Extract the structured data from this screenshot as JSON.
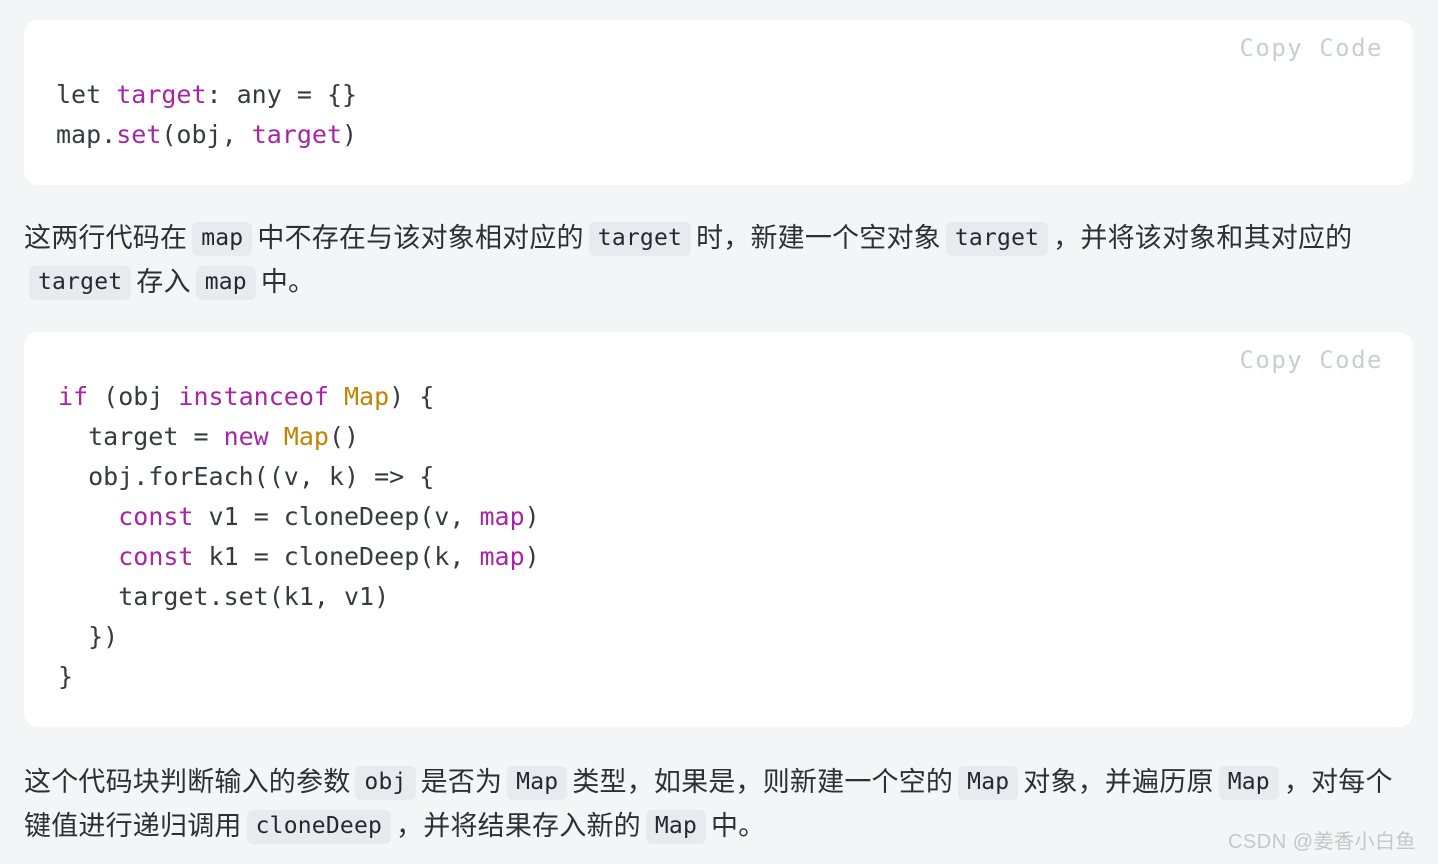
{
  "page": {
    "background": "#f4f5f7",
    "watermark": "CSDN @姜香小白鱼"
  },
  "theme": {
    "code_background": "#ffffff",
    "keyword_color": "#a626a4",
    "class_color": "#c18401",
    "plain_color": "#383a42",
    "copy_label_color": "#c9ced3",
    "chip_background": "#e8eaed"
  },
  "code_block_1": {
    "copy_label": "Copy Code",
    "language": "typescript",
    "lines": [
      {
        "tokens": [
          {
            "text": "let ",
            "kind": "plain"
          },
          {
            "text": "target",
            "kind": "var"
          },
          {
            "text": ": any = {}",
            "kind": "plain"
          }
        ]
      },
      {
        "tokens": [
          {
            "text": "map.",
            "kind": "plain"
          },
          {
            "text": "set",
            "kind": "fn"
          },
          {
            "text": "(obj, ",
            "kind": "plain"
          },
          {
            "text": "target",
            "kind": "var"
          },
          {
            "text": ")",
            "kind": "plain"
          }
        ]
      }
    ],
    "plain_text": "let target: any = {}\nmap.set(obj, target)"
  },
  "paragraph_1": {
    "segments": [
      {
        "type": "text",
        "value": "这两行代码在"
      },
      {
        "type": "code",
        "value": "map"
      },
      {
        "type": "text",
        "value": "中不存在与该对象相对应的"
      },
      {
        "type": "code",
        "value": "target"
      },
      {
        "type": "text",
        "value": "时，新建一个空对象"
      },
      {
        "type": "code",
        "value": "target"
      },
      {
        "type": "text",
        "value": "，并将该对象和其对应的"
      },
      {
        "type": "code",
        "value": "target"
      },
      {
        "type": "text",
        "value": "存入"
      },
      {
        "type": "code",
        "value": "map"
      },
      {
        "type": "text",
        "value": "中。"
      }
    ]
  },
  "code_block_2": {
    "copy_label": "Copy Code",
    "language": "typescript",
    "lines": [
      {
        "tokens": [
          {
            "text": "if",
            "kind": "kw"
          },
          {
            "text": " (obj ",
            "kind": "plain"
          },
          {
            "text": "instanceof",
            "kind": "kw"
          },
          {
            "text": " ",
            "kind": "plain"
          },
          {
            "text": "Map",
            "kind": "cls"
          },
          {
            "text": ") {",
            "kind": "plain"
          }
        ]
      },
      {
        "tokens": [
          {
            "text": "  target = ",
            "kind": "plain"
          },
          {
            "text": "new",
            "kind": "kw"
          },
          {
            "text": " ",
            "kind": "plain"
          },
          {
            "text": "Map",
            "kind": "cls"
          },
          {
            "text": "()",
            "kind": "plain"
          }
        ]
      },
      {
        "tokens": [
          {
            "text": "  obj.forEach((v, k) => {",
            "kind": "plain"
          }
        ]
      },
      {
        "tokens": [
          {
            "text": "    ",
            "kind": "plain"
          },
          {
            "text": "const",
            "kind": "kw"
          },
          {
            "text": " v1 = cloneDeep(v, ",
            "kind": "plain"
          },
          {
            "text": "map",
            "kind": "var"
          },
          {
            "text": ")",
            "kind": "plain"
          }
        ]
      },
      {
        "tokens": [
          {
            "text": "    ",
            "kind": "plain"
          },
          {
            "text": "const",
            "kind": "kw"
          },
          {
            "text": " k1 = cloneDeep(k, ",
            "kind": "plain"
          },
          {
            "text": "map",
            "kind": "var"
          },
          {
            "text": ")",
            "kind": "plain"
          }
        ]
      },
      {
        "tokens": [
          {
            "text": "    target.set(k1, v1)",
            "kind": "plain"
          }
        ]
      },
      {
        "tokens": [
          {
            "text": "  })",
            "kind": "plain"
          }
        ]
      },
      {
        "tokens": [
          {
            "text": "}",
            "kind": "plain"
          }
        ]
      }
    ],
    "plain_text": "if (obj instanceof Map) {\n  target = new Map()\n  obj.forEach((v, k) => {\n    const v1 = cloneDeep(v, map)\n    const k1 = cloneDeep(k, map)\n    target.set(k1, v1)\n  })\n}"
  },
  "paragraph_2": {
    "segments": [
      {
        "type": "text",
        "value": "这个代码块判断输入的参数"
      },
      {
        "type": "code",
        "value": "obj"
      },
      {
        "type": "text",
        "value": "是否为"
      },
      {
        "type": "code",
        "value": "Map"
      },
      {
        "type": "text",
        "value": "类型，如果是，则新建一个空的"
      },
      {
        "type": "code",
        "value": "Map"
      },
      {
        "type": "text",
        "value": "对象，并遍历原"
      },
      {
        "type": "code",
        "value": "Map"
      },
      {
        "type": "text",
        "value": "，对每个键值进行递归调用"
      },
      {
        "type": "code",
        "value": "cloneDeep"
      },
      {
        "type": "text",
        "value": "，并将结果存入新的"
      },
      {
        "type": "code",
        "value": "Map"
      },
      {
        "type": "text",
        "value": "中。"
      }
    ]
  }
}
